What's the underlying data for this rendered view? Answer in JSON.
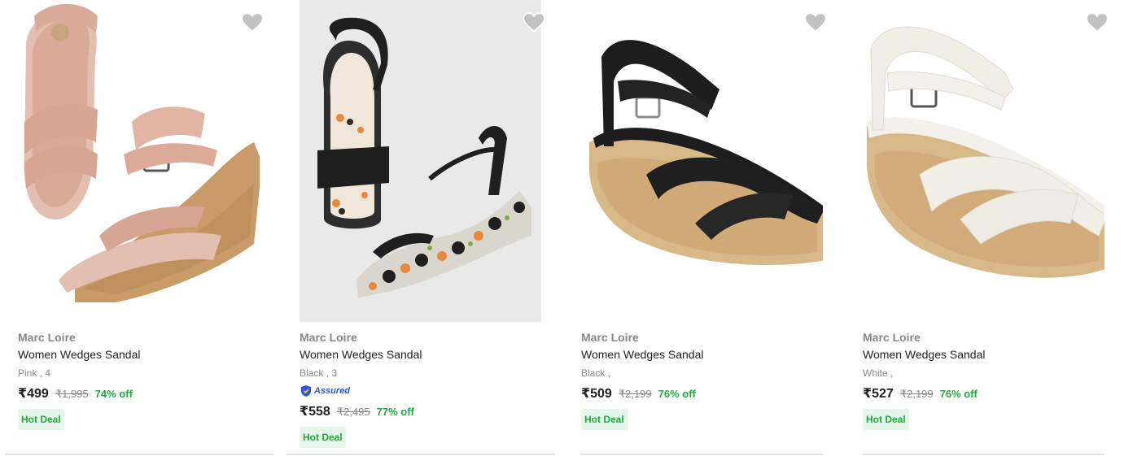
{
  "colors": {
    "accent_green": "#26a541",
    "assured_blue": "#2a55e5",
    "heart_grey": "#c2c2c2"
  },
  "products": [
    {
      "brand": "Marc Loire",
      "title": "Women Wedges Sandal",
      "variant": "Pink , 4",
      "assured": "",
      "price": "₹499",
      "mrp": "₹1,995",
      "discount": "74% off",
      "deal": "Hot Deal",
      "image": "pink-wedge-sandal",
      "icon": "heart-icon"
    },
    {
      "brand": "Marc Loire",
      "title": "Women Wedges Sandal",
      "variant": "Black , 3",
      "assured": "Assured",
      "price": "₹558",
      "mrp": "₹2,495",
      "discount": "77% off",
      "deal": "Hot Deal",
      "image": "black-floral-block-sandal",
      "icon": "heart-icon"
    },
    {
      "brand": "Marc Loire",
      "title": "Women Wedges Sandal",
      "variant": "Black ,",
      "assured": "",
      "price": "₹509",
      "mrp": "₹2,199",
      "discount": "76% off",
      "deal": "Hot Deal",
      "image": "black-wedge-sandal",
      "icon": "heart-icon"
    },
    {
      "brand": "Marc Loire",
      "title": "Women Wedges Sandal",
      "variant": "White ,",
      "assured": "",
      "price": "₹527",
      "mrp": "₹2,199",
      "discount": "76% off",
      "deal": "Hot Deal",
      "image": "white-wedge-sandal",
      "icon": "heart-icon"
    }
  ]
}
